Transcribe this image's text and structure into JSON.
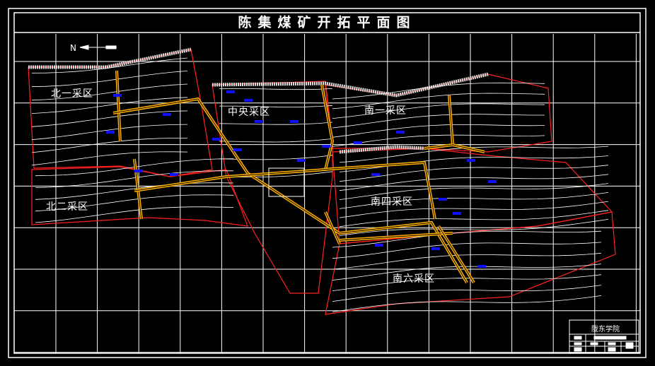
{
  "title": "陈集煤矿开拓平面图",
  "north_label": "N",
  "districts": {
    "bei1": "北一采区",
    "bei2": "北二采区",
    "zhongyang": "中央采区",
    "nan1": "南一采区",
    "nan4": "南四采区",
    "nan6": "南六采区"
  },
  "title_block": {
    "institution": "陇东学院"
  },
  "colors": {
    "background": "#000000",
    "grid": "#ffffff",
    "roadway": "#ffb000",
    "boundary": "#ff2020",
    "fault": "#d06000",
    "blocks": "#1010ff"
  }
}
